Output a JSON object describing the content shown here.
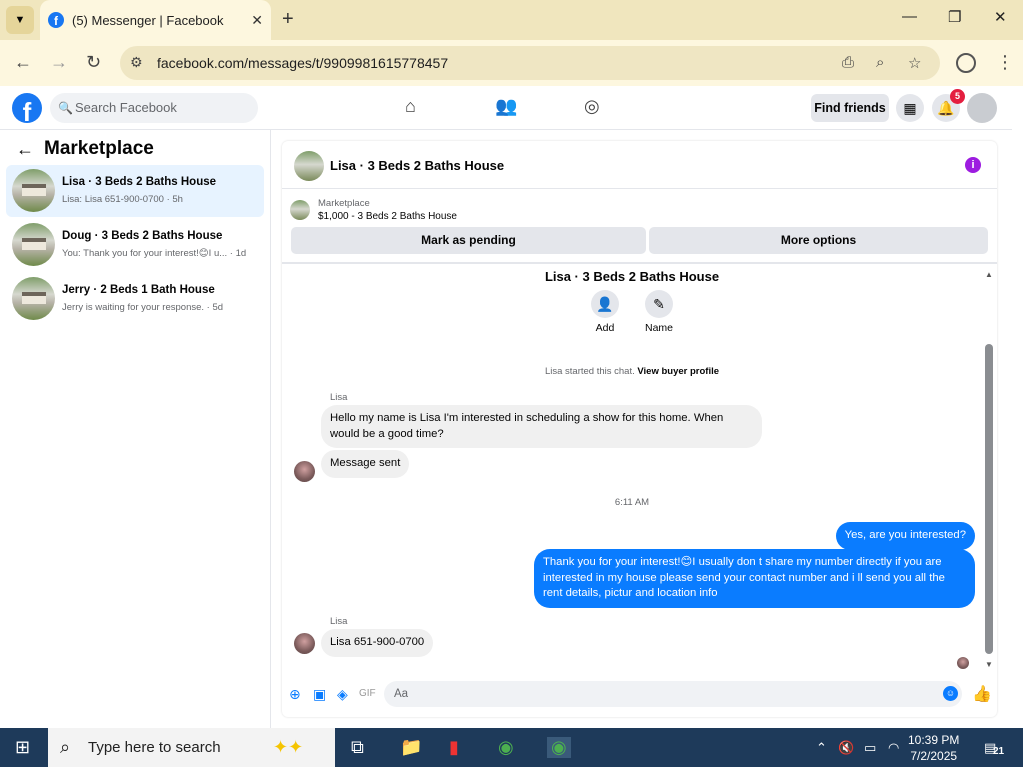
{
  "browser": {
    "tab_title": "(5) Messenger | Facebook",
    "url": "facebook.com/messages/t/9909981615778457"
  },
  "fb": {
    "search_placeholder": "Search Facebook",
    "find_friends": "Find friends",
    "notification_count": "5"
  },
  "sidebar": {
    "title": "Marketplace",
    "conversations": [
      {
        "name": "Lisa · 3 Beds 2 Baths House",
        "preview": "Lisa: Lisa 651-900-0700 · 5h"
      },
      {
        "name": "Doug · 3 Beds 2 Baths House",
        "preview": "You: Thank you for your interest!😊I u... · 1d"
      },
      {
        "name": "Jerry · 2 Beds 1 Bath House",
        "preview": "Jerry is waiting for your response. · 5d"
      }
    ]
  },
  "chat": {
    "title": "Lisa · 3 Beds 2 Baths House",
    "marketplace_label": "Marketplace",
    "listing": "$1,000 - 3 Beds 2 Baths House",
    "mark_pending": "Mark as pending",
    "more_options": "More options",
    "center_title": "Lisa · 3 Beds 2 Baths House",
    "add_label": "Add",
    "name_label": "Name",
    "started_text": "Lisa started this chat.",
    "view_buyer": "View buyer profile",
    "sender1": "Lisa",
    "msg1": "Hello my  name is Lisa I'm interested in scheduling a show for this home. When would be a good time?",
    "msg2": "Message sent",
    "time_stamp": "6:11 AM",
    "msg3": "Yes, are you interested?",
    "msg4": "Thank you for your interest!😊I usually don t share my number directly if you are interested in my house please send your contact number and i ll send you all the rent details, pictur and location info",
    "sender2": "Lisa",
    "msg5": "Lisa 651-900-0700",
    "composer_placeholder": "Aa"
  },
  "taskbar": {
    "search_placeholder": "Type here to search",
    "time": "10:39 PM",
    "date": "7/2/2025",
    "notif_count": "21"
  }
}
